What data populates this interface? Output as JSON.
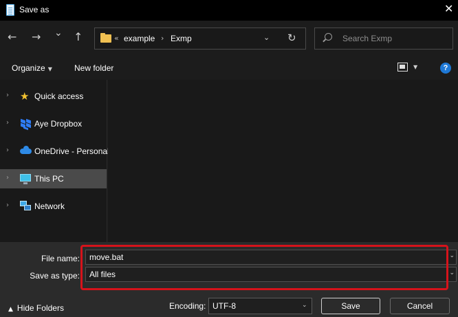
{
  "window": {
    "title": "Save as",
    "close_glyph": "✕",
    "icon": "notepad-icon"
  },
  "nav": {
    "back_glyph": "←",
    "forward_glyph": "→",
    "recent_glyph": "⌄",
    "up_glyph": "↑",
    "address": {
      "overflow_glyph": "«",
      "crumbs": [
        "example",
        "Exmp"
      ],
      "separator": "›",
      "dropdown_glyph": "⌄",
      "refresh_glyph": "↻"
    },
    "search": {
      "placeholder": "Search Exmp"
    }
  },
  "command_bar": {
    "organize_label": "Organize",
    "caret": "▼",
    "new_folder_label": "New folder",
    "help_label": "?"
  },
  "sidebar": {
    "chevron": "›",
    "items": [
      {
        "label": "Quick access",
        "icon": "star-icon",
        "selected": false
      },
      {
        "label": "Aye Dropbox",
        "icon": "dropbox-icon",
        "selected": false
      },
      {
        "label": "OneDrive - Personal",
        "icon": "onedrive-cloud-icon",
        "selected": false
      },
      {
        "label": "This PC",
        "icon": "computer-icon",
        "selected": true
      },
      {
        "label": "Network",
        "icon": "network-icon",
        "selected": false
      }
    ]
  },
  "form": {
    "file_name_label": "File name:",
    "file_name_value": "move.bat",
    "save_type_label": "Save as type:",
    "save_type_value": "All files",
    "dropdown_glyph": "⌄",
    "highlight_color": "#d6131b"
  },
  "footer": {
    "hide_folders_caret": "▲",
    "hide_folders_label": "Hide Folders",
    "encoding_label": "Encoding:",
    "encoding_value": "UTF-8",
    "save_label": "Save",
    "cancel_label": "Cancel"
  },
  "colors": {
    "accent": "#1e78d6",
    "selected_item": "#4a4a4a",
    "folder": "#f0c052"
  }
}
